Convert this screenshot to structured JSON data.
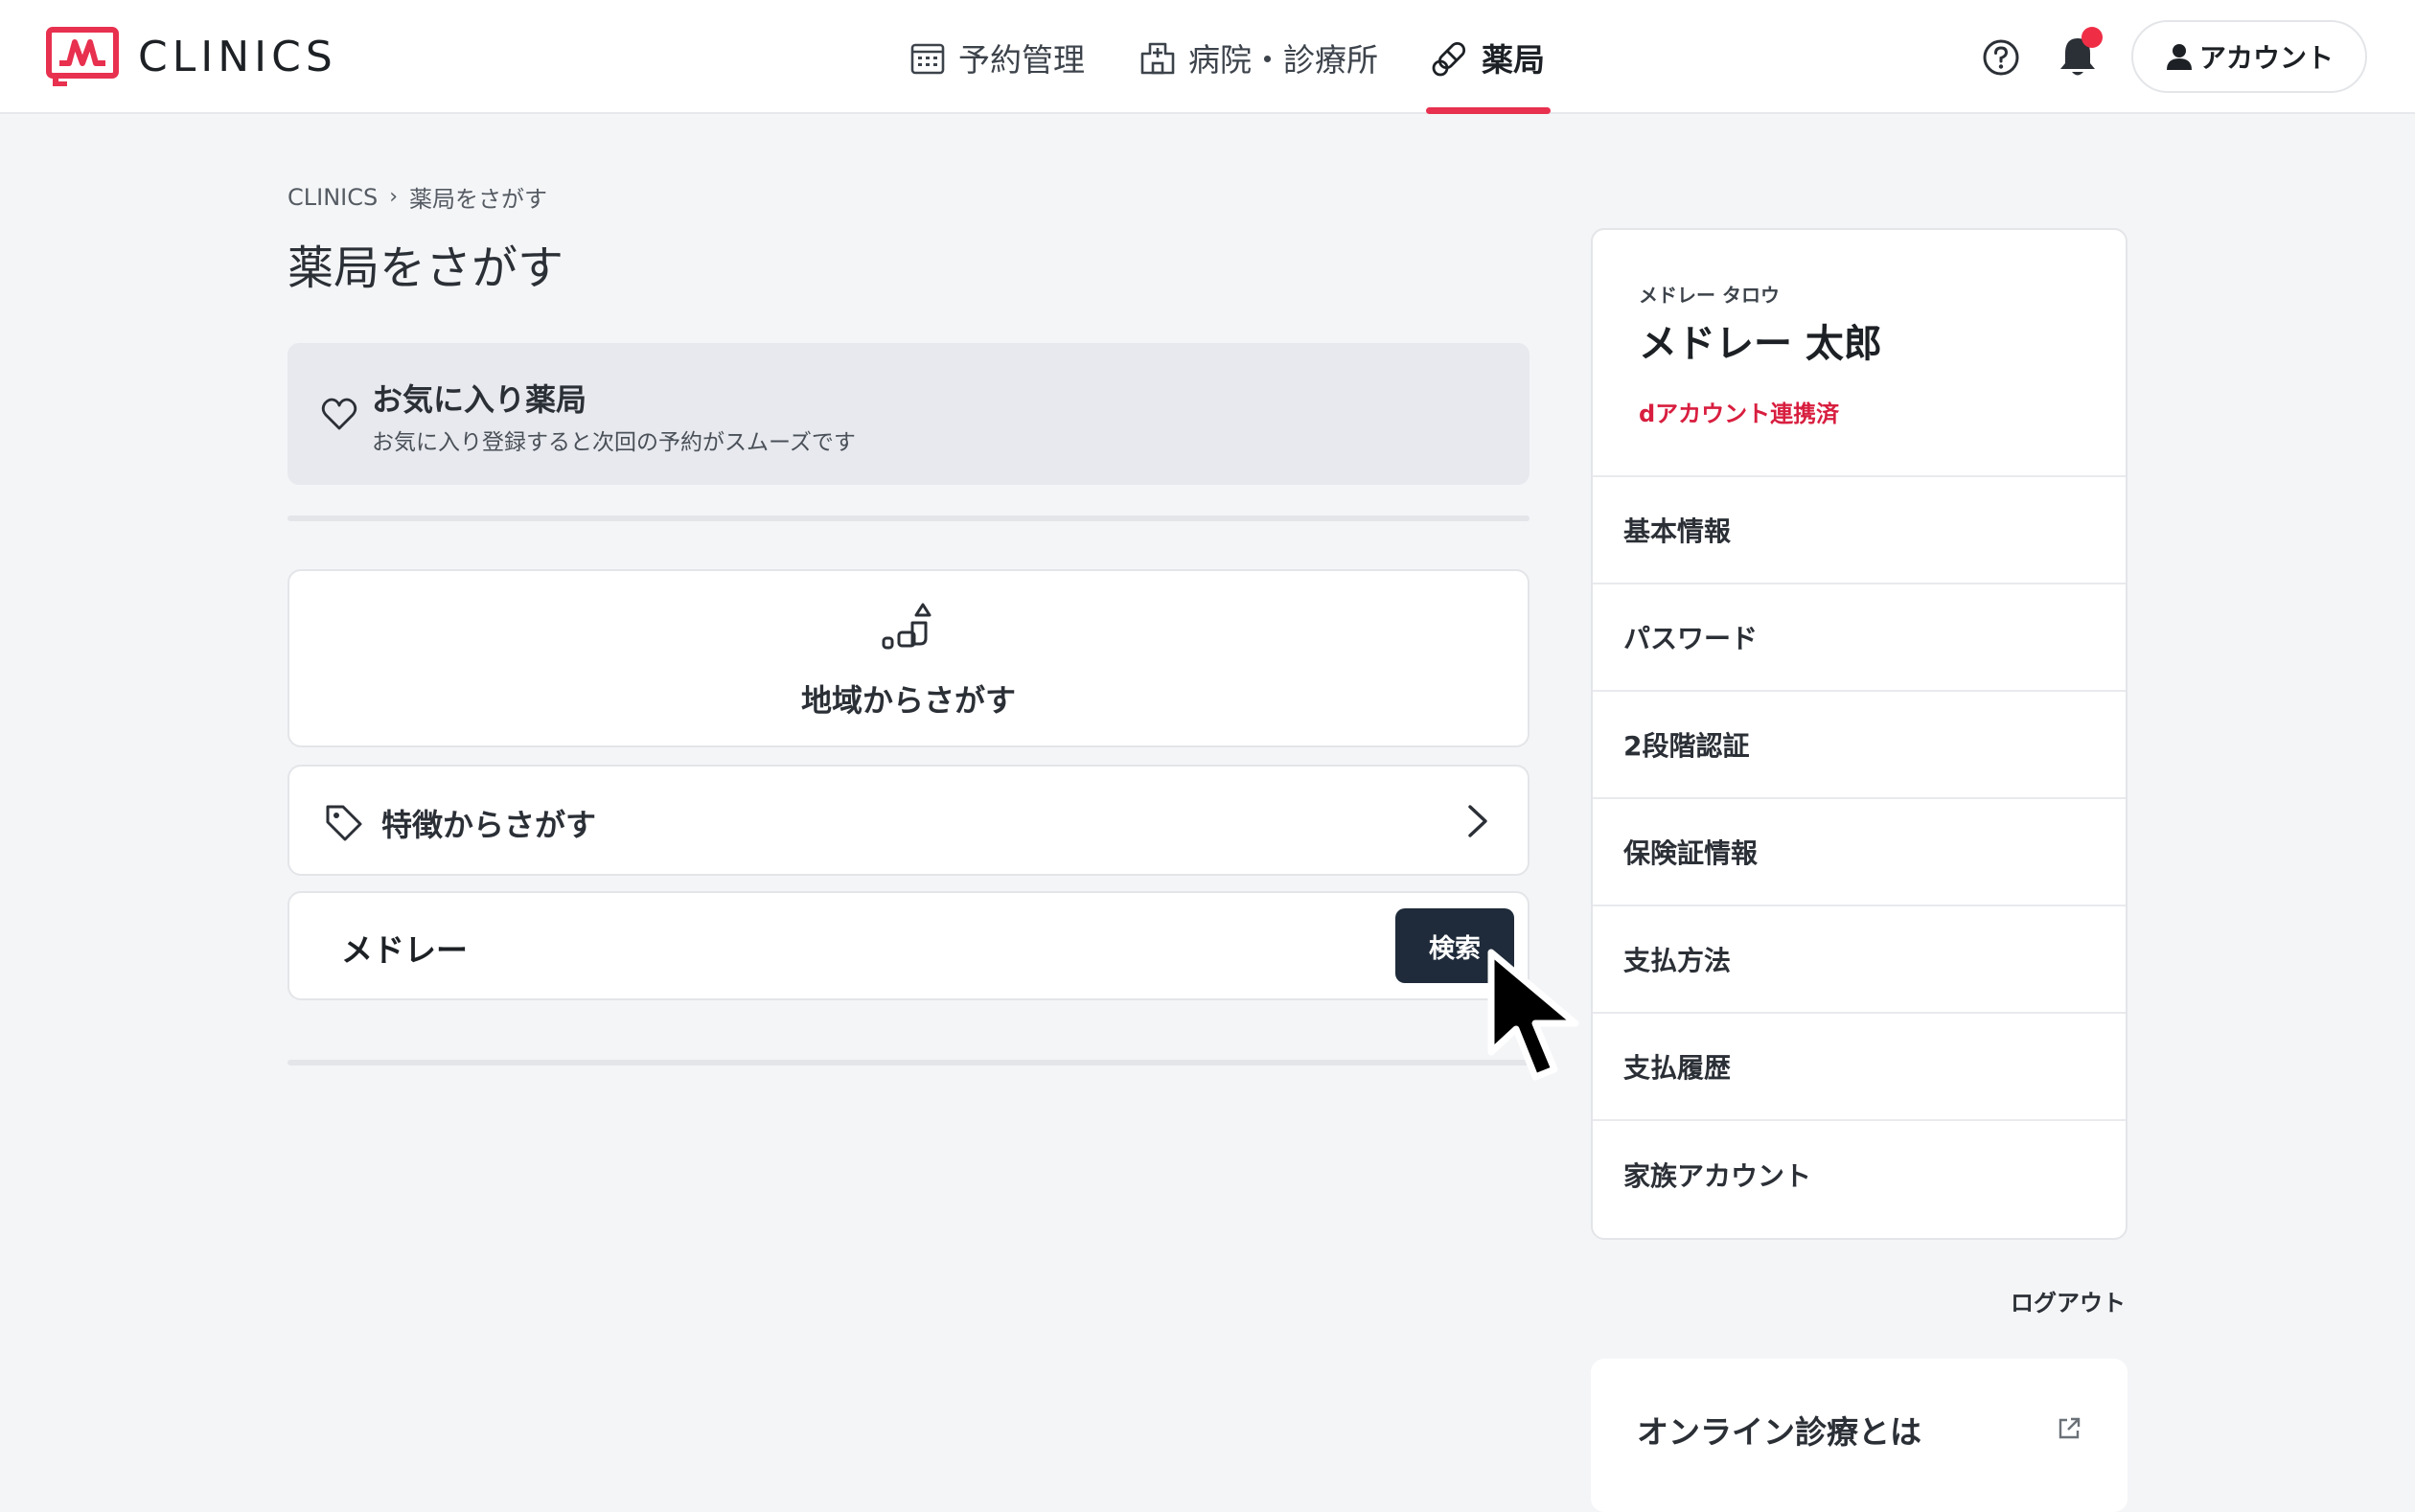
{
  "header": {
    "logo_text": "CLINICS",
    "nav": [
      {
        "label": "予約管理",
        "icon": "calendar-icon"
      },
      {
        "label": "病院・診療所",
        "icon": "hospital-icon"
      },
      {
        "label": "薬局",
        "icon": "pill-icon"
      }
    ],
    "active_nav": "薬局",
    "account_label": "アカウント"
  },
  "breadcrumb": {
    "root": "CLINICS",
    "separator": "›",
    "current": "薬局をさがす"
  },
  "page_title": "薬局をさがす",
  "favorites": {
    "title": "お気に入り薬局",
    "subtitle": "お気に入り登録すると次回の予約がスムーズです"
  },
  "region_search": {
    "label": "地域からさがす"
  },
  "feature_search": {
    "label": "特徴からさがす"
  },
  "keyword_search": {
    "value": "メドレー",
    "button_label": "検索"
  },
  "profile": {
    "kana": "メドレー タロウ",
    "name": "メドレー 太郎",
    "link_status": "dアカウント連携済",
    "menu": [
      "基本情報",
      "パスワード",
      "2段階認証",
      "保険証情報",
      "支払方法",
      "支払履歴",
      "家族アカウント"
    ]
  },
  "logout_label": "ログアウト",
  "online_card": {
    "label": "オンライン診療とは"
  },
  "colors": {
    "accent": "#e8304f",
    "link_red": "#d81e3f",
    "search_button": "#1f2b3a",
    "background": "#f4f5f7"
  }
}
